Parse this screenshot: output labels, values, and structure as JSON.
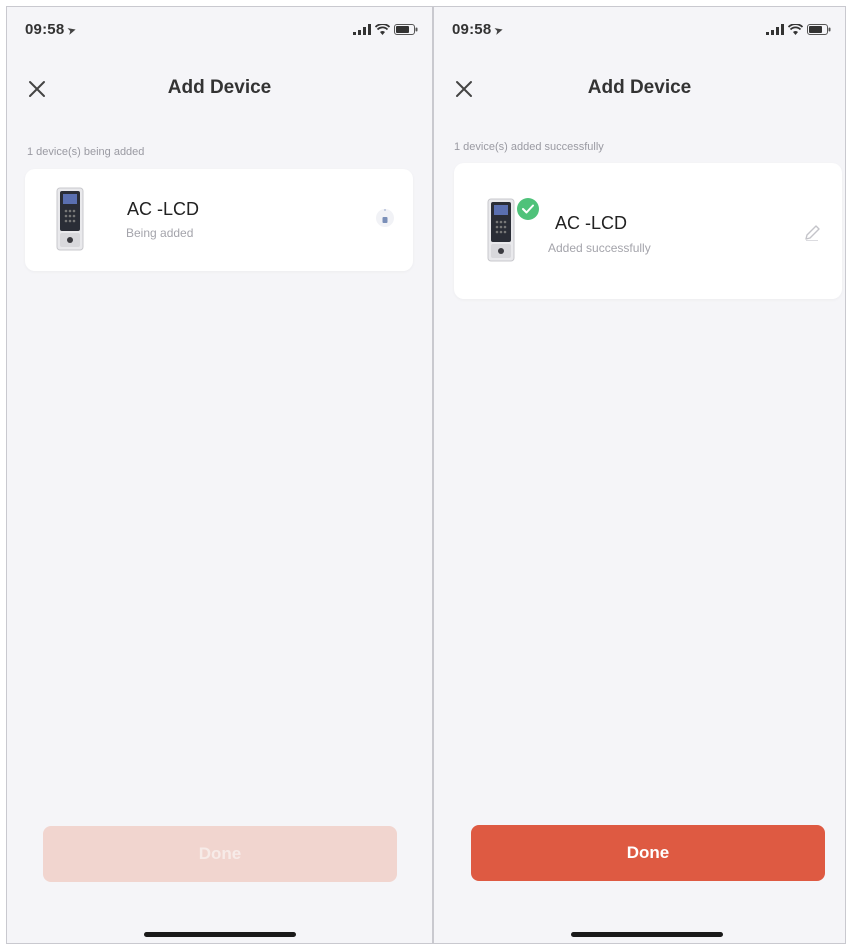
{
  "colors": {
    "accent": "#de5a42",
    "accent_disabled": "#f1d5cf",
    "success": "#4fc27a",
    "background": "#f5f5f8",
    "card": "#ffffff"
  },
  "left_screen": {
    "status_bar": {
      "time": "09:58",
      "location_icon": "location-arrow-icon",
      "icons": [
        "signal-icon",
        "wifi-icon",
        "battery-icon"
      ]
    },
    "nav": {
      "close_icon": "close-icon",
      "title": "Add Device"
    },
    "section_label": "1 device(s) being added",
    "device": {
      "name": "AC -LCD",
      "status": "Being added",
      "icon": "access-control-device-icon",
      "indicator_icon": "loading-spinner-icon"
    },
    "button": {
      "label": "Done",
      "state": "disabled"
    }
  },
  "right_screen": {
    "status_bar": {
      "time": "09:58",
      "location_icon": "location-arrow-icon",
      "icons": [
        "signal-icon",
        "wifi-icon",
        "battery-icon"
      ]
    },
    "nav": {
      "close_icon": "close-icon",
      "title": "Add Device"
    },
    "section_label": "1 device(s) added successfully",
    "device": {
      "name": "AC -LCD",
      "status": "Added successfully",
      "icon": "access-control-device-icon",
      "badge_icon": "check-circle-icon",
      "action_icon": "edit-pencil-icon"
    },
    "button": {
      "label": "Done",
      "state": "enabled"
    }
  }
}
